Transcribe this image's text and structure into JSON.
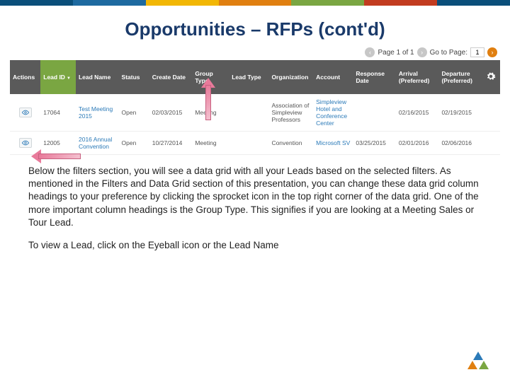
{
  "topbar_colors": [
    "#0a4f7a",
    "#1e6aa0",
    "#f2b705",
    "#e07f10",
    "#7aa642",
    "#c23c20",
    "#0a4f7a"
  ],
  "title": "Opportunities – RFPs (cont'd)",
  "pager": {
    "page_label": "Page 1 of 1",
    "goto_label": "Go to Page:",
    "goto_value": "1"
  },
  "columns": [
    {
      "label": "Actions",
      "w": "40"
    },
    {
      "label": "Lead ID",
      "w": "46",
      "hl": true,
      "sort": true
    },
    {
      "label": "Lead Name",
      "w": "56"
    },
    {
      "label": "Status",
      "w": "40"
    },
    {
      "label": "Create Date",
      "w": "56"
    },
    {
      "label": "Group Type",
      "w": "48"
    },
    {
      "label": "Lead Type",
      "w": "52"
    },
    {
      "label": "Organization",
      "w": "58"
    },
    {
      "label": "Account",
      "w": "52"
    },
    {
      "label": "Response Date",
      "w": "56"
    },
    {
      "label": "Arrival (Preferred)",
      "w": "56"
    },
    {
      "label": "Departure (Preferred)",
      "w": "56"
    },
    {
      "label": "",
      "w": "24",
      "gear": true
    }
  ],
  "rows": [
    {
      "id": "17064",
      "name": "Test Meeting 2015",
      "status": "Open",
      "create": "02/03/2015",
      "gtype": "Meeting",
      "ltype": "",
      "org": "Association of Simpleview Professors",
      "acct": "Simpleview Hotel and Conference Center",
      "resp": "",
      "arr": "02/16/2015",
      "dep": "02/19/2015"
    },
    {
      "id": "12005",
      "name": "2016 Annual Convention",
      "status": "Open",
      "create": "10/27/2014",
      "gtype": "Meeting",
      "ltype": "",
      "org": "Convention",
      "acct": "Microsoft SV",
      "resp": "03/25/2015",
      "arr": "02/01/2016",
      "dep": "02/06/2016",
      "note": "Simpleview Hotel and Conference Center"
    }
  ],
  "body": {
    "p1": "Below the filters section, you will see a data grid with all your Leads based on the selected filters.  As mentioned in the Filters and Data Grid section of this presentation, you can change these data grid column headings to your preference by clicking the sprocket icon in the top right corner of the data grid.  One of the more important column headings is the Group Type.  This signifies if you are looking at a Meeting Sales or Tour Lead.",
    "p2": "To view a Lead, click on the Eyeball icon or the Lead Name"
  }
}
